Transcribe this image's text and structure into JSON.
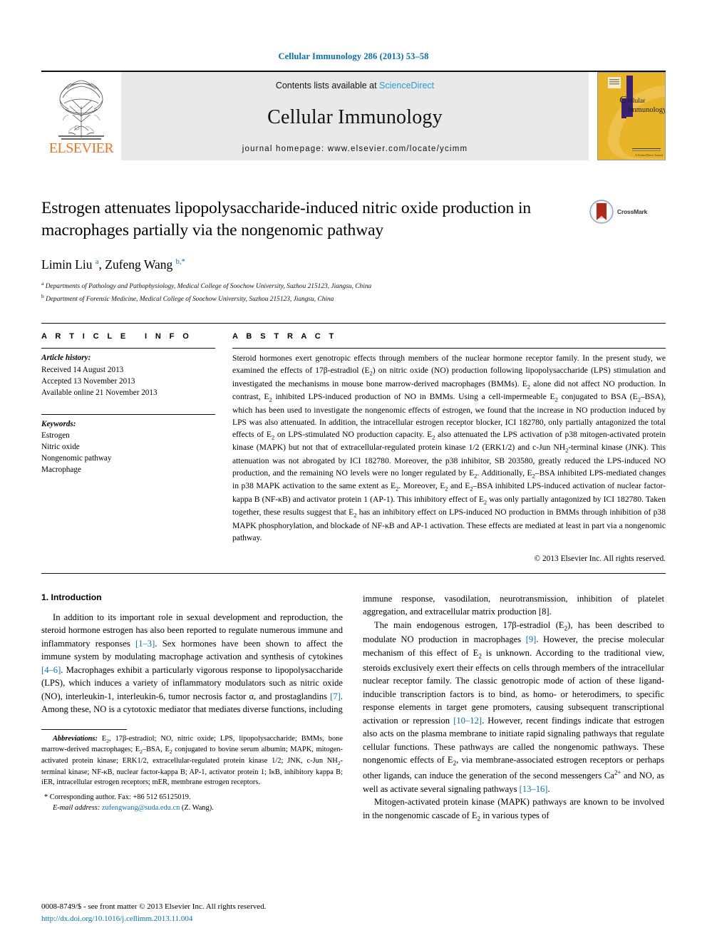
{
  "running_head": "Cellular Immunology 286 (2013) 53–58",
  "masthead": {
    "publisher_wordmark": "ELSEVIER",
    "contents_prefix": "Contents lists available at ",
    "contents_link": "ScienceDirect",
    "journal_name": "Cellular Immunology",
    "homepage_line": "journal homepage: www.elsevier.com/locate/ycimm",
    "cover_title_line1": "ellular",
    "cover_title_line2": "Immunology"
  },
  "article": {
    "title": "Estrogen attenuates lipopolysaccharide-induced nitric oxide production in macrophages partially via the nongenomic pathway",
    "crossmark_label": "CrossMark",
    "authors": "Limin Liu a, Zufeng Wang b,*",
    "affiliations": [
      "a Departments of Pathology and Pathophysiology, Medical College of Soochow University, Suzhou 215123, Jiangsu, China",
      "b Department of Forensic Medicine, Medical College of Soochow University, Suzhou 215123, Jiangsu, China"
    ]
  },
  "info": {
    "heading": "ARTICLE INFO",
    "history_label": "Article history:",
    "history": [
      "Received 14 August 2013",
      "Accepted 13 November 2013",
      "Available online 21 November 2013"
    ],
    "keywords_label": "Keywords:",
    "keywords": [
      "Estrogen",
      "Nitric oxide",
      "Nongenomic pathway",
      "Macrophage"
    ]
  },
  "abstract": {
    "heading": "ABSTRACT",
    "text": "Steroid hormones exert genotropic effects through members of the nuclear hormone receptor family. In the present study, we examined the effects of 17β-estradiol (E2) on nitric oxide (NO) production following lipopolysaccharide (LPS) stimulation and investigated the mechanisms in mouse bone marrow-derived macrophages (BMMs). E2 alone did not affect NO production. In contrast, E2 inhibited LPS-induced production of NO in BMMs. Using a cell-impermeable E2 conjugated to BSA (E2–BSA), which has been used to investigate the nongenomic effects of estrogen, we found that the increase in NO production induced by LPS was also attenuated. In addition, the intracellular estrogen receptor blocker, ICI 182780, only partially antagonized the total effects of E2 on LPS-stimulated NO production capacity. E2 also attenuated the LPS activation of p38 mitogen-activated protein kinase (MAPK) but not that of extracellular-regulated protein kinase 1/2 (ERK1/2) and c-Jun NH2-terminal kinase (JNK). This attenuation was not abrogated by ICI 182780. Moreover, the p38 inhibitor, SB 203580, greatly reduced the LPS-induced NO production, and the remaining NO levels were no longer regulated by E2. Additionally, E2–BSA inhibited LPS-mediated changes in p38 MAPK activation to the same extent as E2. Moreover, E2 and E2–BSA inhibited LPS-induced activation of nuclear factor-kappa B (NF-κB) and activator protein 1 (AP-1). This inhibitory effect of E2 was only partially antagonized by ICI 182780. Taken together, these results suggest that E2 has an inhibitory effect on LPS-induced NO production in BMMs through inhibition of p38 MAPK phosphorylation, and blockade of NF-κB and AP-1 activation. These effects are mediated at least in part via a nongenomic pathway.",
    "copyright": "© 2013 Elsevier Inc. All rights reserved."
  },
  "introduction": {
    "heading": "1. Introduction",
    "left_paragraph": "In addition to its important role in sexual development and reproduction, the steroid hormone estrogen has also been reported to regulate numerous immune and inflammatory responses [1–3]. Sex hormones have been shown to affect the immune system by modulating macrophage activation and synthesis of cytokines [4–6]. Macrophages exhibit a particularly vigorous response to lipopolysaccharide (LPS), which induces a variety of inflammatory modulators such as nitric oxide (NO), interleukin-1, interleukin-6, tumor necrosis factor α, and prostaglandins [7]. Among these, NO is a cytotoxic mediator that mediates diverse functions, including",
    "right_paragraph_1": "immune response, vasodilation, neurotransmission, inhibition of platelet aggregation, and extracellular matrix production [8].",
    "right_paragraph_2": "The main endogenous estrogen, 17β-estradiol (E2), has been described to modulate NO production in macrophages [9]. However, the precise molecular mechanism of this effect of E2 is unknown. According to the traditional view, steroids exclusively exert their effects on cells through members of the intracellular nuclear receptor family. The classic genotropic mode of action of these ligand-inducible transcription factors is to bind, as homo- or heterodimers, to specific response elements in target gene promoters, causing subsequent transcriptional activation or repression [10–12]. However, recent findings indicate that estrogen also acts on the plasma membrane to initiate rapid signaling pathways that regulate cellular functions. These pathways are called the nongenomic pathways. These nongenomic effects of E2, via membrane-associated estrogen receptors or perhaps other ligands, can induce the generation of the second messengers Ca2+ and NO, as well as activate several signaling pathways [13–16].",
    "right_paragraph_3": "Mitogen-activated protein kinase (MAPK) pathways are known to be involved in the nongenomic cascade of E2 in various types of"
  },
  "footnotes": {
    "abbreviations_label": "Abbreviations:",
    "abbreviations_text": "E2, 17β-estradiol; NO, nitric oxide; LPS, lipopolysaccharide; BMMs, bone marrow-derived macrophages; E2–BSA, E2 conjugated to bovine serum albumin; MAPK, mitogen-activated protein kinase; ERK1/2, extracellular-regulated protein kinase 1/2; JNK, c-Jun NH2-terminal kinase; NF-κB, nuclear factor-kappa B; AP-1, activator protein 1; IκB, inhibitory kappa B; iER, intracellular estrogen receptors; mER, membrane estrogen receptors.",
    "corresponding": "* Corresponding author. Fax: +86 512 65125019.",
    "email_label": "E-mail address:",
    "email": "zufengwang@suda.edu.cn",
    "email_suffix": "(Z. Wang)."
  },
  "footer": {
    "issn_line": "0008-8749/$ - see front matter © 2013 Elsevier Inc. All rights reserved.",
    "doi_line": "http://dx.doi.org/10.1016/j.cellimm.2013.11.004"
  },
  "colors": {
    "link": "#0b6ea8",
    "sciencedirect": "#2b9bd4",
    "elsevier_orange": "#e87722",
    "cover_yellow": "#e8b52a",
    "crossmark_red": "#b02a19"
  }
}
